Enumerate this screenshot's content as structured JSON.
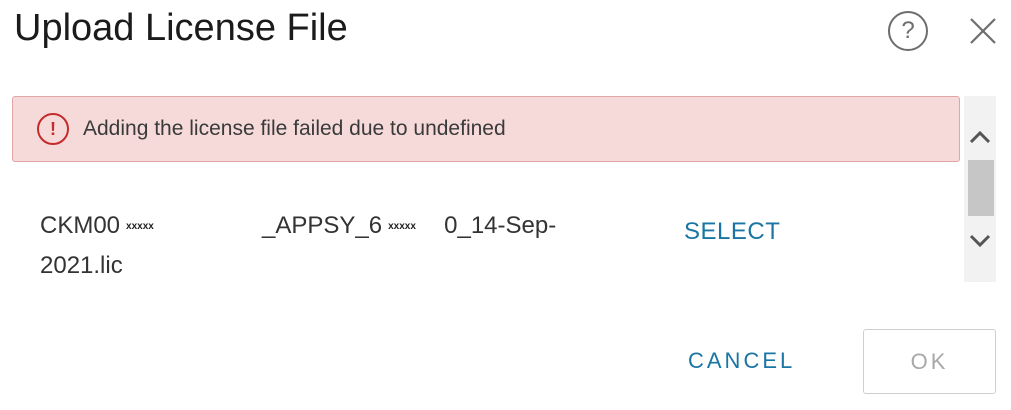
{
  "dialog": {
    "title": "Upload License File",
    "help_icon_glyph": "?",
    "close_icon": "close-icon"
  },
  "alert": {
    "icon": "error-icon",
    "icon_glyph": "!",
    "message": "Adding the license file failed due to undefined",
    "colors": {
      "background": "#f6dada",
      "border": "#e2a4a4",
      "icon": "#c52b2b"
    }
  },
  "file": {
    "part1": "CKM00",
    "redacted1": "xxxxx",
    "part2": "_APPSY_6",
    "redacted2": "xxxxx",
    "part3": "0_14-Sep-2021.lic"
  },
  "actions": {
    "select_label": "SELECT",
    "cancel_label": "CANCEL",
    "ok_label": "OK"
  },
  "colors": {
    "accent": "#1a75a3",
    "disabled": "#a8a8a8"
  }
}
